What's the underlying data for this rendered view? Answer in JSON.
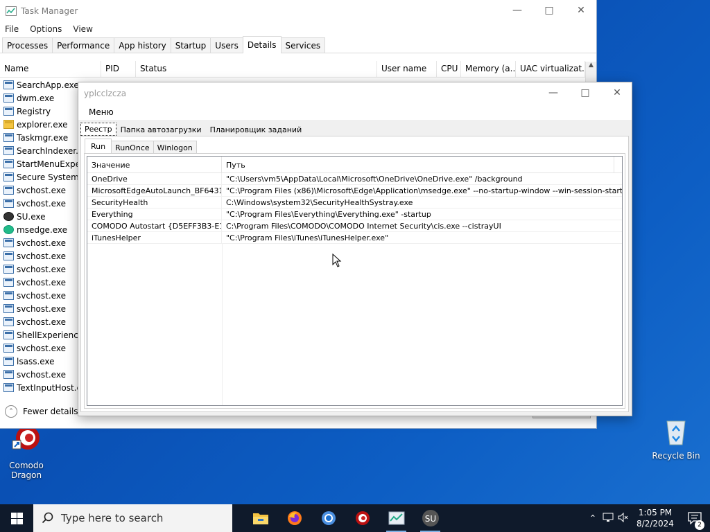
{
  "desktop": {
    "icons": [
      {
        "label": "Comodo Dragon"
      },
      {
        "label": "Recycle Bin"
      }
    ]
  },
  "task_manager": {
    "title": "Task Manager",
    "menu": [
      "File",
      "Options",
      "View"
    ],
    "tabs": [
      "Processes",
      "Performance",
      "App history",
      "Startup",
      "Users",
      "Details",
      "Services"
    ],
    "active_tab": "Details",
    "columns": [
      "Name",
      "PID",
      "Status",
      "User name",
      "CPU",
      "Memory (a...",
      "UAC virtualizat..."
    ],
    "processes": [
      "SearchApp.exe",
      "dwm.exe",
      "Registry",
      "explorer.exe",
      "Taskmgr.exe",
      "SearchIndexer.exe",
      "StartMenuExperi",
      "Secure System",
      "svchost.exe",
      "svchost.exe",
      "SU.exe",
      "msedge.exe",
      "svchost.exe",
      "svchost.exe",
      "svchost.exe",
      "svchost.exe",
      "svchost.exe",
      "svchost.exe",
      "svchost.exe",
      "ShellExperienceH",
      "svchost.exe",
      "lsass.exe",
      "svchost.exe",
      "TextInputHost.ex"
    ],
    "fewer_details": "Fewer details"
  },
  "dialog": {
    "title": "yplcclzcza",
    "menu": "Меню",
    "tabs": [
      "Реестр",
      "Папка автозагрузки",
      "Планировщик заданий"
    ],
    "subtabs": [
      "Run",
      "RunOnce",
      "Winlogon"
    ],
    "columns": {
      "value": "Значение",
      "path": "Путь"
    },
    "rows": [
      {
        "value": "OneDrive",
        "path": "\"C:\\Users\\vm5\\AppData\\Local\\Microsoft\\OneDrive\\OneDrive.exe\" /background"
      },
      {
        "value": "MicrosoftEdgeAutoLaunch_BF64314...",
        "path": "\"C:\\Program Files (x86)\\Microsoft\\Edge\\Application\\msedge.exe\" --no-startup-window --win-session-start"
      },
      {
        "value": "SecurityHealth",
        "path": "C:\\Windows\\system32\\SecurityHealthSystray.exe"
      },
      {
        "value": "Everything",
        "path": "\"C:\\Program Files\\Everything\\Everything.exe\" -startup"
      },
      {
        "value": "COMODO Autostart {D5EFF3B3-E12...",
        "path": "C:\\Program Files\\COMODO\\COMODO Internet Security\\cis.exe --cistrayUI"
      },
      {
        "value": "iTunesHelper",
        "path": "\"C:\\Program Files\\iTunes\\iTunesHelper.exe\""
      }
    ]
  },
  "taskbar": {
    "search_placeholder": "Type here to search",
    "apps": [
      "file-explorer",
      "firefox",
      "chrome",
      "comodo-dragon",
      "task-manager",
      "su"
    ],
    "su_label": "SU",
    "time": "1:05 PM",
    "date": "8/2/2024",
    "notification_count": "2"
  }
}
